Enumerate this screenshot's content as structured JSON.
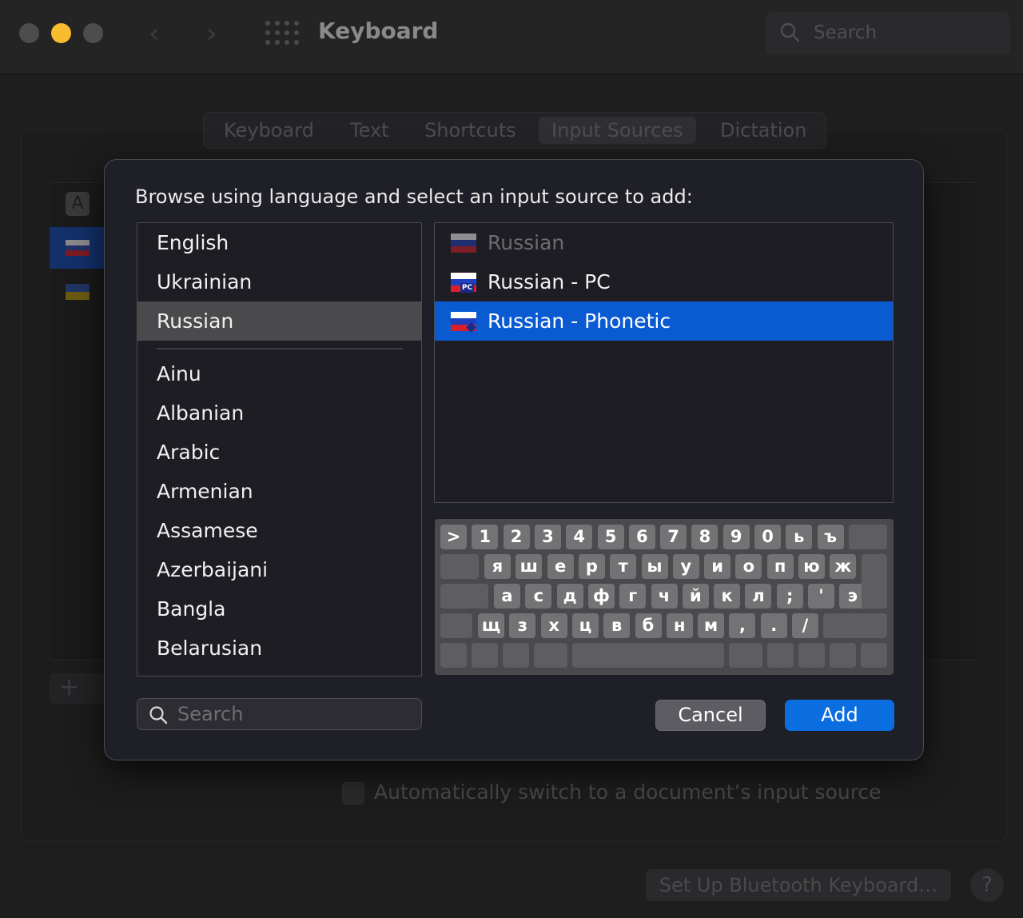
{
  "window": {
    "title": "Keyboard",
    "search_placeholder": "Search"
  },
  "tabs": [
    {
      "label": "Keyboard",
      "selected": false
    },
    {
      "label": "Text",
      "selected": false
    },
    {
      "label": "Shortcuts",
      "selected": false
    },
    {
      "label": "Input Sources",
      "selected": true
    },
    {
      "label": "Dictation",
      "selected": false
    }
  ],
  "background": {
    "input_source_a": "A",
    "add_button": "+",
    "auto_switch_label": "Automatically switch to a document’s input source",
    "auto_switch_checked": false,
    "bluetooth_button": "Set Up Bluetooth Keyboard…",
    "help_button": "?"
  },
  "sheet": {
    "prompt": "Browse using language and select an input source to add:",
    "languages_top": [
      "English",
      "Ukrainian",
      "Russian"
    ],
    "languages_all": [
      "Ainu",
      "Albanian",
      "Arabic",
      "Armenian",
      "Assamese",
      "Azerbaijani",
      "Bangla",
      "Belarusian"
    ],
    "selected_language": "Russian",
    "sources": [
      {
        "label": "Russian",
        "badge": "",
        "state": "disabled"
      },
      {
        "label": "Russian - PC",
        "badge": "PC",
        "state": "normal"
      },
      {
        "label": "Russian - Phonetic",
        "badge": "",
        "state": "selected"
      }
    ],
    "keyboard_rows": [
      [
        ">",
        "1",
        "2",
        "3",
        "4",
        "5",
        "6",
        "7",
        "8",
        "9",
        "0",
        "ь",
        "ъ"
      ],
      [
        "я",
        "ш",
        "е",
        "р",
        "т",
        "ы",
        "у",
        "и",
        "о",
        "п",
        "ю",
        "ж"
      ],
      [
        "а",
        "с",
        "д",
        "ф",
        "г",
        "ч",
        "й",
        "к",
        "л",
        ";",
        "'",
        "э"
      ],
      [
        "щ",
        "з",
        "х",
        "ц",
        "в",
        "б",
        "н",
        "м",
        ",",
        ".",
        "/"
      ]
    ],
    "search_placeholder": "Search",
    "cancel_label": "Cancel",
    "add_label": "Add"
  },
  "colors": {
    "accent": "#0a6ee0",
    "selection": "#0a5bd1",
    "minimize": "#f7bd2e"
  }
}
